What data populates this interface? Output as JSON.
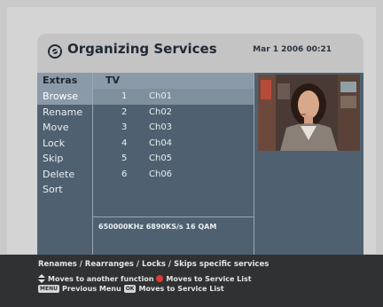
{
  "header": {
    "title": "Organizing Services",
    "datetime": "Mar 1 2006 00:21"
  },
  "menu": {
    "heading": "Extras",
    "items": [
      "Browse",
      "Rename",
      "Move",
      "Lock",
      "Skip",
      "Delete",
      "Sort"
    ],
    "selected": "Browse"
  },
  "list": {
    "heading": "TV",
    "rows": [
      {
        "num": "1",
        "name": "Ch01"
      },
      {
        "num": "2",
        "name": "Ch02"
      },
      {
        "num": "3",
        "name": "Ch03"
      },
      {
        "num": "4",
        "name": "Ch04"
      },
      {
        "num": "5",
        "name": "Ch05"
      },
      {
        "num": "6",
        "name": "Ch06"
      }
    ],
    "selected_index": 0,
    "info": "650000KHz 6890KS/s 16 QAM"
  },
  "footer": {
    "hint": "Renames / Rearranges / Locks / Skips specific services",
    "help1_text": "Moves to another function",
    "help1_text2": "Moves to Service List",
    "help2_key1": "MENU",
    "help2_text": "Previous Menu",
    "help2_key2": "OK",
    "help2_text2": "Moves to Service List"
  },
  "colors": {
    "accent_red": "#e03a2e",
    "panel_blue": "#4f6170",
    "highlight": "#8a9aa8"
  },
  "icons": {
    "logo": "globe-logo-icon",
    "arrows": "up-down-arrows-icon",
    "red": "red-button-icon"
  }
}
